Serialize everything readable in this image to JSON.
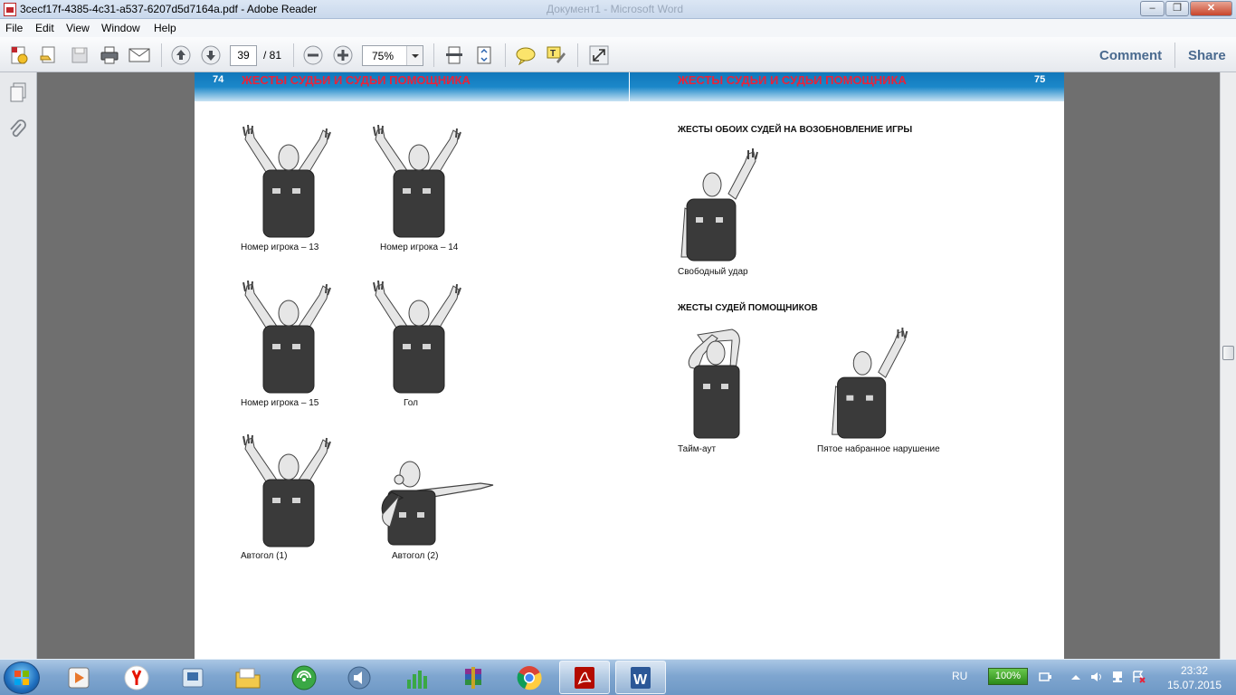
{
  "window": {
    "title": "3cecf17f-4385-4c31-a537-6207d5d7164a.pdf - Adobe Reader",
    "background_title": "Документ1 - Microsoft Word",
    "controls": [
      "minimize",
      "maximize",
      "close"
    ]
  },
  "menu": [
    "File",
    "Edit",
    "View",
    "Window",
    "Help"
  ],
  "toolbar": {
    "current_page": "39",
    "total_pages": "/ 81",
    "zoom": "75%",
    "comment_label": "Comment",
    "share_label": "Share",
    "icons": [
      "create-pdf-icon",
      "open-icon",
      "save-icon",
      "print-icon",
      "email-icon",
      "previous-page-icon",
      "next-page-icon",
      "zoom-out-icon",
      "zoom-in-icon",
      "fit-page-icon",
      "fit-width-icon",
      "sticky-note-icon",
      "highlight-icon",
      "fullscreen-icon"
    ]
  },
  "left_nav": {
    "icons": [
      "pages-icon",
      "attachments-icon"
    ]
  },
  "document": {
    "left_page": {
      "number": "74",
      "header": "ЖЕСТЫ СУДЬИ И СУДЬИ ПОМОЩНИКА",
      "figures": [
        {
          "caption": "Номер игрока – 13",
          "pose": "both-arms-up"
        },
        {
          "caption": "Номер игрока – 14",
          "pose": "both-arms-up"
        },
        {
          "caption": "Номер игрока – 15",
          "pose": "both-arms-up"
        },
        {
          "caption": "Гол",
          "pose": "both-arms-up"
        },
        {
          "caption": "Автогол (1)",
          "pose": "both-arms-up"
        },
        {
          "caption": "Автогол (2)",
          "pose": "whistle-arm-out"
        }
      ]
    },
    "right_page": {
      "number": "75",
      "header": "ЖЕСТЫ СУДЬИ И СУДЬИ ПОМОЩНИКА",
      "section1_heading": "ЖЕСТЫ ОБОИХ СУДЕЙ НА ВОЗОБНОВЛЕНИЕ ИГРЫ",
      "section2_heading": "ЖЕСТЫ СУДЕЙ ПОМОЩНИКОВ",
      "figures": [
        {
          "caption": "Свободный удар",
          "pose": "one-arm-up"
        },
        {
          "caption": "Тайм-аут",
          "pose": "time-out"
        },
        {
          "caption": "Пятое набранное нарушение",
          "pose": "one-arm-up"
        }
      ]
    }
  },
  "taskbar": {
    "apps": [
      "media-player-icon",
      "yandex-browser-icon",
      "app-icon",
      "explorer-icon",
      "network-icon",
      "audio-icon",
      "chart-app-icon",
      "winrar-icon",
      "chrome-icon",
      "adobe-reader-icon",
      "word-icon"
    ],
    "active_apps": [
      "adobe-reader-icon",
      "word-icon"
    ],
    "language": "RU",
    "battery": "100%",
    "time": "23:32",
    "date": "15.07.2015"
  },
  "colors": {
    "header_blue": "#1b87c9",
    "header_red": "#e8233a",
    "shirt": "#3a3a3a",
    "skin": "#e6e6e6"
  }
}
